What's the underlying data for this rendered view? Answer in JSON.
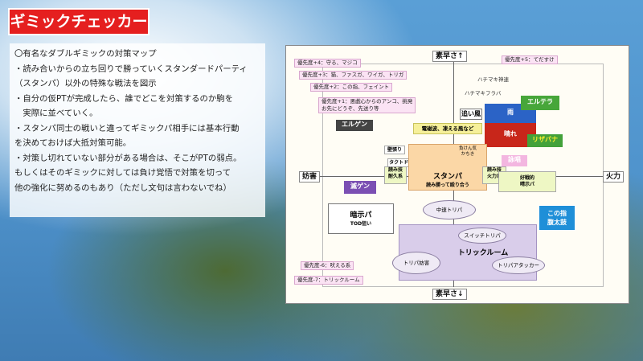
{
  "title": "ギミックチェッカー",
  "text_lines": [
    "〇有名なダブルギミックの対策マップ",
    "・読み合いからの立ち回りで勝っていくスタンダードパーティ",
    "（スタンパ）以外の特殊な戦法を図示",
    "・自分の仮PTが完成したら、誰でどこを対策するのか駒を",
    "　実際に並べていく。",
    "・スタンパ同士の戦いと違ってギミックパ相手には基本行動",
    "を決めておけば大抵対策可能。",
    "・対策し切れていない部分がある場合は、そこがPTの弱点。",
    "もしくはそのギミックに対しては負け覚悟で対策を切って",
    "他の強化に努めるのもあり（ただし文句は言わないでね）"
  ],
  "axes": {
    "top": "素早さ↑",
    "bottom": "素早さ↓",
    "left": "妨害",
    "right": "火力"
  },
  "tags": {
    "p4": "優先度+4：守る、マジコ",
    "p3": "優先度+3：猫、ファスガ、ワイガ、トリガ",
    "p2": "優先度+2：この指、フェイント",
    "p1": "優先度+1：悪戯心からのアンコ、挑発\nお先にどうぞ、先送り等",
    "p5": "優先度+5：てだすけ",
    "pm6": "優先度-6：吠える系",
    "pm7": "優先度-7：トリックルーム"
  },
  "labels": {
    "hachimaki": "ハチマキ神速",
    "hachimaki_fl": "ハチマキフラバ",
    "oikaze": "追い風",
    "ame": "雨",
    "hare": "晴れ",
    "elterra": "エルテラ",
    "risaba": "リザバナ",
    "erugen": "エルゲン",
    "denjiha": "電磁波、凍える風など",
    "shiyou": "詠唱",
    "kabeduri": "壁張り",
    "takuto": "タクトドーブル",
    "makenki": "負けん気\nかちき",
    "stanpa": "スタンパ",
    "stanpa_sub": "読み勝って殴り合う",
    "yomi_taikyu": "読み技\n耐久系",
    "yomi_karyoku": "読み技\n火力系",
    "koukiteki": "好戦的\n晴示パ",
    "metsugen": "滅ゲン",
    "konoyubi": "この指\n腹太鼓",
    "anjipa": "暗示パ",
    "anjipa_sub": "TOD狙い",
    "chusoku": "中速トリパ",
    "trickroom": "トリックルーム",
    "switch": "スイッチトリパ",
    "bougai": "トリパ妨害",
    "attacker": "トリパアタッカー"
  }
}
